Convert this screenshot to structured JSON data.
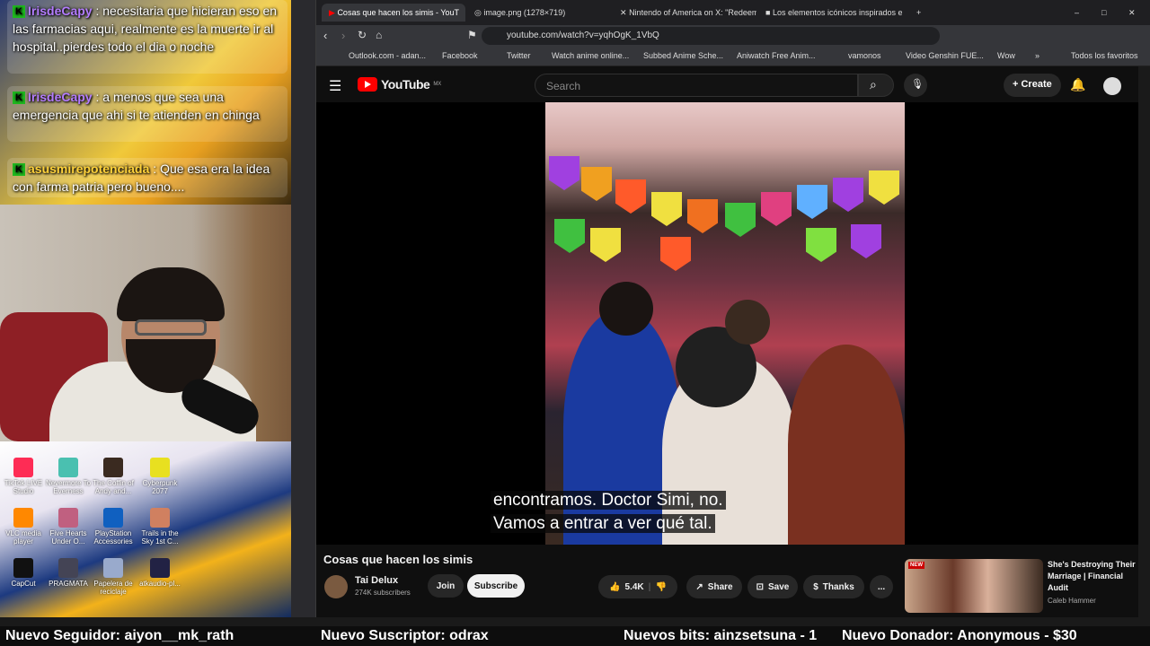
{
  "chat": {
    "messages": [
      {
        "user": "IrisdeCapy",
        "sep": ":",
        "text": "necesitaria que hicieran eso en las farmacias aqui, realmente es la muerte ir al hospital..pierdes todo el dia o noche"
      },
      {
        "user": "IrisdeCapy",
        "sep": ":",
        "text": "a menos que sea una emergencia que ahi si te atienden en chinga"
      },
      {
        "user": "asusmirepotenciada",
        "sep": ":",
        "text": "Que esa era la idea con farma patria pero bueno...."
      }
    ]
  },
  "desktop": {
    "icons": [
      "TikTok LIVE Studio",
      "Nevermore To Everness",
      "The Coffin of Andy and...",
      "Cyberpunk 2077",
      "VLC media player",
      "Five Hearts Under O...",
      "PlayStation Accessories",
      "Trails in the Sky 1st C...",
      "CapCut",
      "PRAGMATA",
      "Papelera de reciclaje",
      "atkaudio-pl..."
    ]
  },
  "browser": {
    "tabs": [
      {
        "label": "Cosas que hacen los simis - YouT",
        "active": true
      },
      {
        "label": "image.png (1278×719)",
        "active": false
      },
      {
        "label": "Nintendo of America on X: \"Redeem",
        "active": false
      },
      {
        "label": "Los elementos icónicos inspirados en",
        "active": false
      }
    ],
    "new_tab": "+",
    "url": "youtube.com/watch?v=yqhOgK_1VbQ",
    "bookmarks": [
      "Outlook.com - adan...",
      "Facebook",
      "Twitter",
      "Watch anime online...",
      "Subbed Anime Sche...",
      "Aniwatch Free Anim...",
      "vamonos",
      "Video Genshin FUE...",
      "Wow",
      "»",
      "Todos los favoritos"
    ]
  },
  "youtube": {
    "logo": "YouTube",
    "region": "MX",
    "search_placeholder": "Search",
    "create_label": "Create",
    "subtitles": [
      "encontramos. Doctor Simi, no.",
      "Vamos a entrar a ver qué tal."
    ],
    "video_title": "Cosas que hacen los simis",
    "channel": {
      "name": "Tai Delux",
      "subscribers": "274K subscribers"
    },
    "join_label": "Join",
    "subscribe_label": "Subscribe",
    "likes": "5.4K",
    "share_label": "Share",
    "save_label": "Save",
    "thanks_label": "Thanks",
    "more_label": "...",
    "recommended": {
      "title": "She's Destroying Their Marriage | Financial Audit",
      "channel": "Caleb Hammer",
      "badge": "NEW"
    }
  },
  "ticker": {
    "follower": "Nuevo Seguidor: aiyon__mk_rath",
    "subscriber": "Nuevo Suscriptor: odrax",
    "bits": "Nuevos bits: ainzsetsuna - 1",
    "donor": "Nuevo Donador: Anonymous - $30"
  },
  "colors": {
    "youtube_red": "#ff0000",
    "chat_user": "#b47cff",
    "yt_bg": "#0f0f0f"
  }
}
